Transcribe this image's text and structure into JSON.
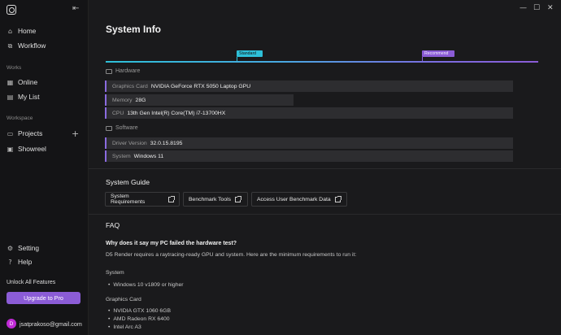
{
  "sidebar": {
    "collapse_icon": "collapse-left-icon",
    "nav": [
      {
        "label": "Home",
        "icon": "home-icon"
      },
      {
        "label": "Workflow",
        "icon": "workflow-icon"
      }
    ],
    "works_label": "Works",
    "works": [
      {
        "label": "Online",
        "icon": "grid-icon"
      },
      {
        "label": "My List",
        "icon": "book-icon"
      }
    ],
    "workspace_label": "Workspace",
    "workspace": [
      {
        "label": "Projects",
        "icon": "folder-icon"
      },
      {
        "label": "Showreel",
        "icon": "film-icon"
      }
    ],
    "bottom": [
      {
        "label": "Setting",
        "icon": "gear-icon"
      },
      {
        "label": "Help",
        "icon": "help-icon"
      }
    ],
    "unlock_label": "Unlock All Features",
    "upgrade_label": "Upgrade to Pro",
    "account": {
      "initial": "D",
      "email": "jsatprakoso@gmail.com"
    }
  },
  "window_controls": {
    "minimize": "—",
    "maximize": "☐",
    "close": "✕"
  },
  "main": {
    "title": "System Info",
    "ranking": {
      "standard": "Standard",
      "recommend": "Recommend"
    },
    "hardware_label": "Hardware",
    "hardware": [
      {
        "key": "Graphics Card",
        "value": "NVIDIA GeForce RTX 5050 Laptop GPU"
      },
      {
        "key": "Memory",
        "value": "28G"
      },
      {
        "key": "CPU",
        "value": "13th Gen Intel(R) Core(TM) i7-13700HX"
      }
    ],
    "software_label": "Software",
    "software": [
      {
        "key": "Driver Version",
        "value": "32.0.15.8195"
      },
      {
        "key": "System",
        "value": "Windows 11"
      }
    ],
    "guide_title": "System Guide",
    "guide_buttons": [
      "System Requirements",
      "Benchmark Tools",
      "Access User Benchmark Data"
    ],
    "faq_title": "FAQ",
    "faq": {
      "question": "Why does it say my PC failed the hardware test?",
      "answer": "D5 Render requires a raytracing-ready GPU and system. Here are the minimum requirements to run it:",
      "system_label": "System",
      "system_items": [
        "Windows 10 v1809 or higher"
      ],
      "gpu_label": "Graphics Card",
      "gpu_items": [
        "NVIDIA GTX 1060 6GB",
        "AMD Radeon RX 6400",
        "Intel Arc A3"
      ]
    }
  }
}
